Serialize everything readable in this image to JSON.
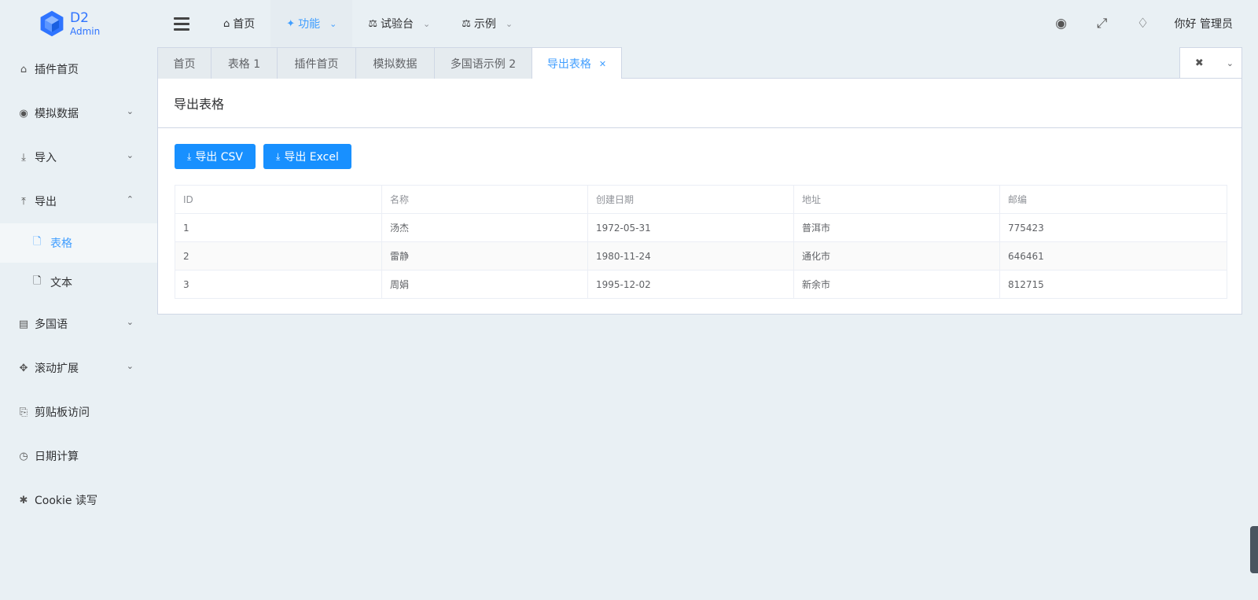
{
  "logo": {
    "title": "D2",
    "subtitle": "Admin"
  },
  "topnav": [
    {
      "label": "首页",
      "icon": "home-icon",
      "active": false,
      "dropdown": false
    },
    {
      "label": "功能",
      "icon": "puzzle-icon",
      "active": true,
      "dropdown": true
    },
    {
      "label": "试验台",
      "icon": "flask-icon",
      "active": false,
      "dropdown": true
    },
    {
      "label": "示例",
      "icon": "flask-icon",
      "active": false,
      "dropdown": true
    }
  ],
  "header_right": {
    "user_label": "你好 管理员",
    "icons": [
      "target-icon",
      "fullscreen-icon",
      "diamond-icon"
    ]
  },
  "sidebar": {
    "items": [
      {
        "label": "插件首页",
        "icon": "home-icon"
      },
      {
        "label": "模拟数据",
        "icon": "globe-icon",
        "chevron": "down"
      },
      {
        "label": "导入",
        "icon": "download-icon",
        "chevron": "down"
      },
      {
        "label": "导出",
        "icon": "upload-icon",
        "chevron": "up"
      },
      {
        "label": "多国语",
        "icon": "translate-icon",
        "chevron": "down"
      },
      {
        "label": "滚动扩展",
        "icon": "crosshairs-icon",
        "chevron": "down"
      },
      {
        "label": "剪贴板访问",
        "icon": "clipboard-icon"
      },
      {
        "label": "日期计算",
        "icon": "clock-icon"
      },
      {
        "label": "Cookie 读写",
        "icon": "asterisk-icon"
      }
    ],
    "sub_items": [
      {
        "label": "表格",
        "icon": "file-icon",
        "active": true
      },
      {
        "label": "文本",
        "icon": "file-icon",
        "active": false
      }
    ]
  },
  "tabs": [
    {
      "label": "首页"
    },
    {
      "label": "表格 1"
    },
    {
      "label": "插件首页"
    },
    {
      "label": "模拟数据"
    },
    {
      "label": "多国语示例 2"
    },
    {
      "label": "导出表格",
      "active": true
    }
  ],
  "page": {
    "title": "导出表格",
    "buttons": {
      "csv": "导出 CSV",
      "excel": "导出 Excel"
    }
  },
  "table": {
    "headers": [
      "ID",
      "名称",
      "创建日期",
      "地址",
      "邮编"
    ],
    "rows": [
      [
        "1",
        "汤杰",
        "1972-05-31",
        "普洱市",
        "775423"
      ],
      [
        "2",
        "雷静",
        "1980-11-24",
        "通化市",
        "646461"
      ],
      [
        "3",
        "周娟",
        "1995-12-02",
        "新余市",
        "812715"
      ]
    ]
  },
  "colors": {
    "accent": "#409eff",
    "button": "#1890ff",
    "background": "#e9f0f4"
  }
}
